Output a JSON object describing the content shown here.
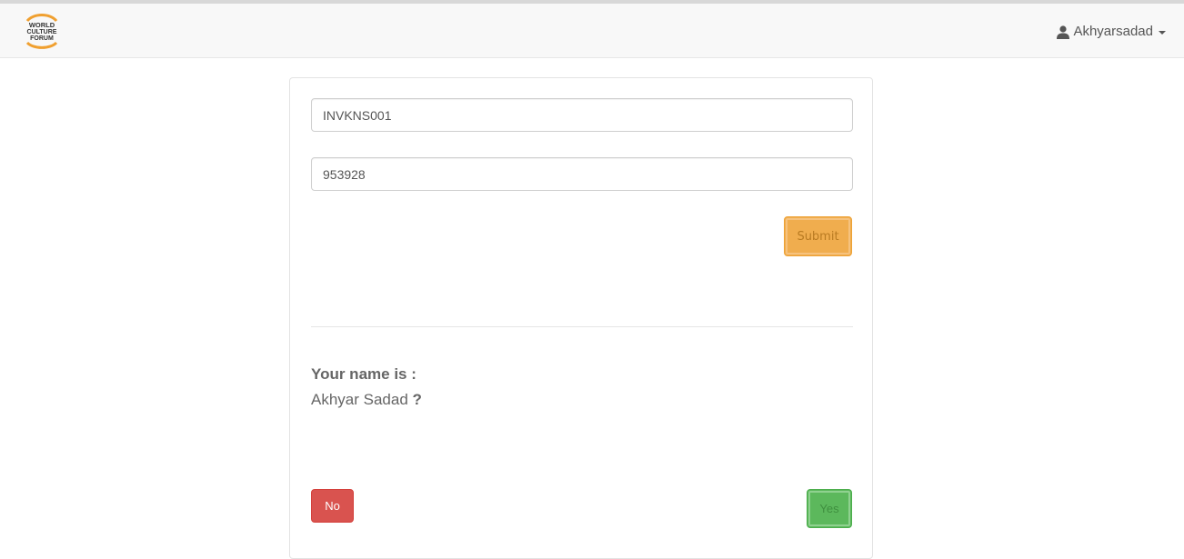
{
  "brand": {
    "logo_lines": [
      "WORLD",
      "CULTURE",
      "FORUM"
    ],
    "logo_color": "#f0a030"
  },
  "user_menu": {
    "username": "Akhyarsadad",
    "icon": "user-icon"
  },
  "form": {
    "field1_value": "INVKNS001",
    "field2_value": "953928",
    "submit_label": "Submit"
  },
  "confirm": {
    "label": "Your name is :",
    "name": "Akhyar Sadad",
    "question_mark": "?",
    "no_label": "No",
    "yes_label": "Yes"
  },
  "colors": {
    "submit": "#f0ad4e",
    "no": "#d9534f",
    "yes": "#5cb85c"
  }
}
